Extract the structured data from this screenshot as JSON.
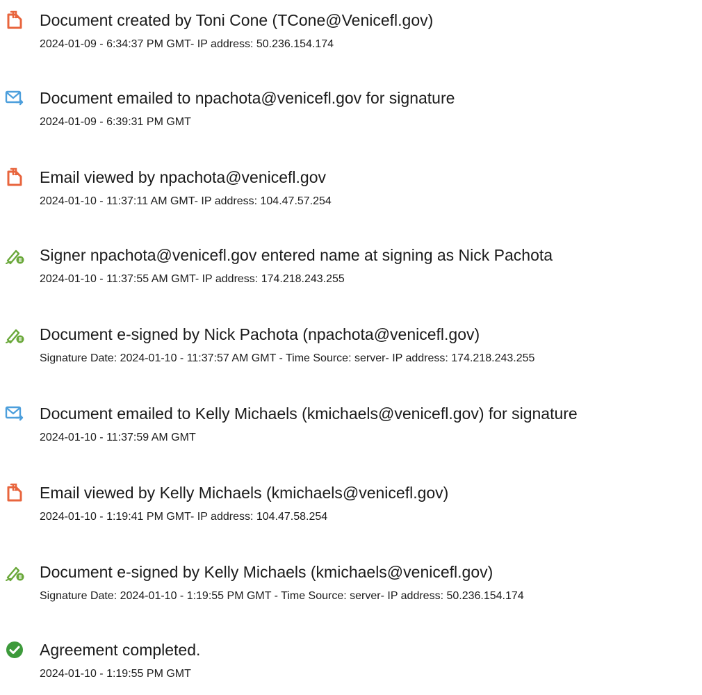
{
  "events": [
    {
      "icon": "document-created-icon",
      "title": "Document created by Toni Cone (TCone@Venicefl.gov)",
      "detail": "2024-01-09 - 6:34:37 PM GMT- IP address: 50.236.154.174"
    },
    {
      "icon": "email-sent-icon",
      "title": "Document emailed to npachota@venicefl.gov for signature",
      "detail": "2024-01-09 - 6:39:31 PM GMT"
    },
    {
      "icon": "document-viewed-icon",
      "title": "Email viewed by npachota@venicefl.gov",
      "detail": "2024-01-10 - 11:37:11 AM GMT- IP address: 104.47.57.254"
    },
    {
      "icon": "e-sign-pen-icon",
      "title": "Signer npachota@venicefl.gov entered name at signing as Nick Pachota",
      "detail": "2024-01-10 - 11:37:55 AM GMT- IP address: 174.218.243.255"
    },
    {
      "icon": "e-sign-pen-icon",
      "title": "Document e-signed by Nick Pachota (npachota@venicefl.gov)",
      "detail": "Signature Date: 2024-01-10 - 11:37:57 AM GMT - Time Source: server- IP address: 174.218.243.255"
    },
    {
      "icon": "email-sent-icon",
      "title": "Document emailed to Kelly Michaels (kmichaels@venicefl.gov) for signature",
      "detail": "2024-01-10 - 11:37:59 AM GMT"
    },
    {
      "icon": "document-viewed-icon",
      "title": "Email viewed by Kelly Michaels (kmichaels@venicefl.gov)",
      "detail": "2024-01-10 - 1:19:41 PM GMT- IP address: 104.47.58.254"
    },
    {
      "icon": "e-sign-pen-icon",
      "title": "Document e-signed by Kelly Michaels (kmichaels@venicefl.gov)",
      "detail": "Signature Date: 2024-01-10 - 1:19:55 PM GMT - Time Source: server- IP address: 50.236.154.174"
    },
    {
      "icon": "completed-check-icon",
      "title": "Agreement completed.",
      "detail": "2024-01-10 - 1:19:55 PM GMT"
    }
  ],
  "colors": {
    "document_icon": "#e8653d",
    "email_icon": "#4d9fdc",
    "pen_icon": "#6aa83a",
    "check_icon": "#3d9a3b"
  }
}
